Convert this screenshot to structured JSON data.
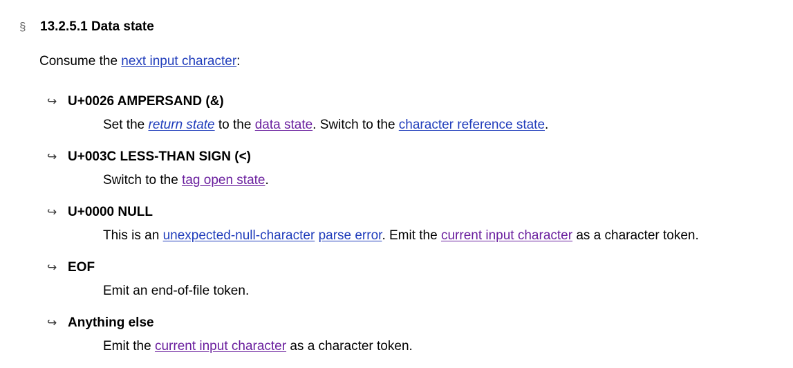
{
  "heading": {
    "mark": "§",
    "title": "13.2.5.1 Data state"
  },
  "intro": {
    "before": "Consume the ",
    "link": "next input character",
    "after": ":"
  },
  "cases": [
    {
      "title": "U+0026 AMPERSAND (&)",
      "body": {
        "t1": "Set the ",
        "l1": "return state",
        "t2": " to the ",
        "l2": "data state",
        "t3": ". Switch to the ",
        "l3": "character reference state",
        "t4": "."
      }
    },
    {
      "title": "U+003C LESS-THAN SIGN (<)",
      "body": {
        "t1": "Switch to the ",
        "l1": "tag open state",
        "t2": "."
      }
    },
    {
      "title": "U+0000 NULL",
      "body": {
        "t1": "This is an ",
        "l1": "unexpected-null-character",
        "t2": " ",
        "l2": "parse error",
        "t3": ". Emit the ",
        "l3": "current input character",
        "t4": " as a character token."
      }
    },
    {
      "title": "EOF",
      "body": {
        "t1": "Emit an end-of-file token."
      }
    },
    {
      "title": "Anything else",
      "body": {
        "t1": "Emit the ",
        "l1": "current input character",
        "t2": " as a character token."
      }
    }
  ],
  "icons": {
    "section": "section-sign-icon",
    "case_arrow": "hook-arrow-icon"
  },
  "colors": {
    "link_unvisited": "#1f3cbb",
    "link_visited": "#6a1f9e",
    "section_mark": "#6a6a6a"
  }
}
